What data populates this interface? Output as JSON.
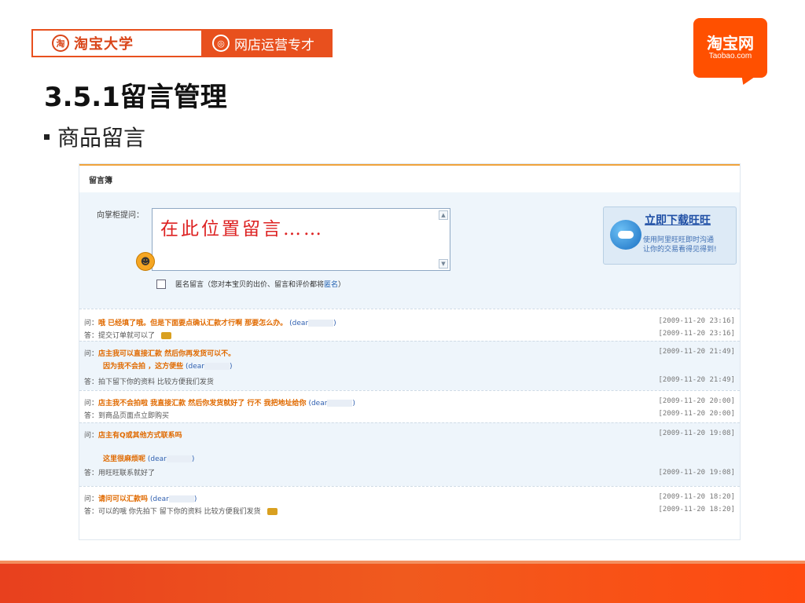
{
  "brand": {
    "left_seal": "淘",
    "left_text": "淘宝大学",
    "right_text": "网店运营专才"
  },
  "logo": {
    "main": "淘宝网",
    "sub": "Taobao.com"
  },
  "slide": {
    "title": "3.5.1留言管理",
    "bullet": "商品留言"
  },
  "board": {
    "header": "留言簿",
    "ask_label": "向掌柜提问：",
    "textbox_text": "在此位置留言……",
    "anon_label": "匿名留言（您对本宝贝的出价、留言和评价都将",
    "anon_link": "匿名",
    "anon_tail": "）"
  },
  "wangwang": {
    "title": "立即下载旺旺",
    "sub1": "使用阿里旺旺即时沟通",
    "sub2": "让你的交易看得见得到!"
  },
  "messages": [
    {
      "q_label": "问：",
      "q_text": "哦 已经填了哦。但是下面要点确认汇款才行啊 那要怎么办。",
      "nick": "(dear",
      "nick_close": ")",
      "q_time": "[2009-11-20 23:16]",
      "a_label": "答：",
      "a_text": "提交订单就可以了",
      "a_time": "[2009-11-20 23:16]"
    },
    {
      "q_label": "问：",
      "q_text": "店主我可以直接汇款 然后你再发货可以不。",
      "q_text2": "因为我不会拍 ，这方便些",
      "nick": "(dear",
      "nick_close": ")",
      "q_time": "[2009-11-20 21:49]",
      "a_label": "答：",
      "a_text": "拍下留下你的资料 比较方便我们发货",
      "a_time": "[2009-11-20 21:49]"
    },
    {
      "q_label": "问：",
      "q_text": "店主我不会拍啦 我直接汇款 然后你发货就好了 行不 我把地址给你",
      "nick": "(dear",
      "nick_close": ")",
      "q_time": "[2009-11-20 20:00]",
      "a_label": "答：",
      "a_text": "到商品页面点立即购买",
      "a_time": "[2009-11-20 20:00]"
    },
    {
      "q_label": "问：",
      "q_text": "店主有Q或其他方式联系吗",
      "q_text2": "这里很麻烦呢",
      "nick": "(dear",
      "nick_close": ")",
      "q_time": "[2009-11-20 19:08]",
      "a_label": "答：",
      "a_text": "用旺旺联系就好了",
      "a_time": "[2009-11-20 19:08]"
    },
    {
      "q_label": "问：",
      "q_text": "请问可以汇款吗",
      "nick": "(dear",
      "nick_close": ")",
      "q_time": "[2009-11-20 18:20]",
      "a_label": "答：",
      "a_text": "可以的哦 你先拍下 留下你的资料 比较方便我们发货",
      "a_time": "[2009-11-20 18:20]"
    }
  ],
  "colors": {
    "brand_orange": "#e8501e",
    "question": "#e06a00",
    "link": "#2060b0"
  }
}
